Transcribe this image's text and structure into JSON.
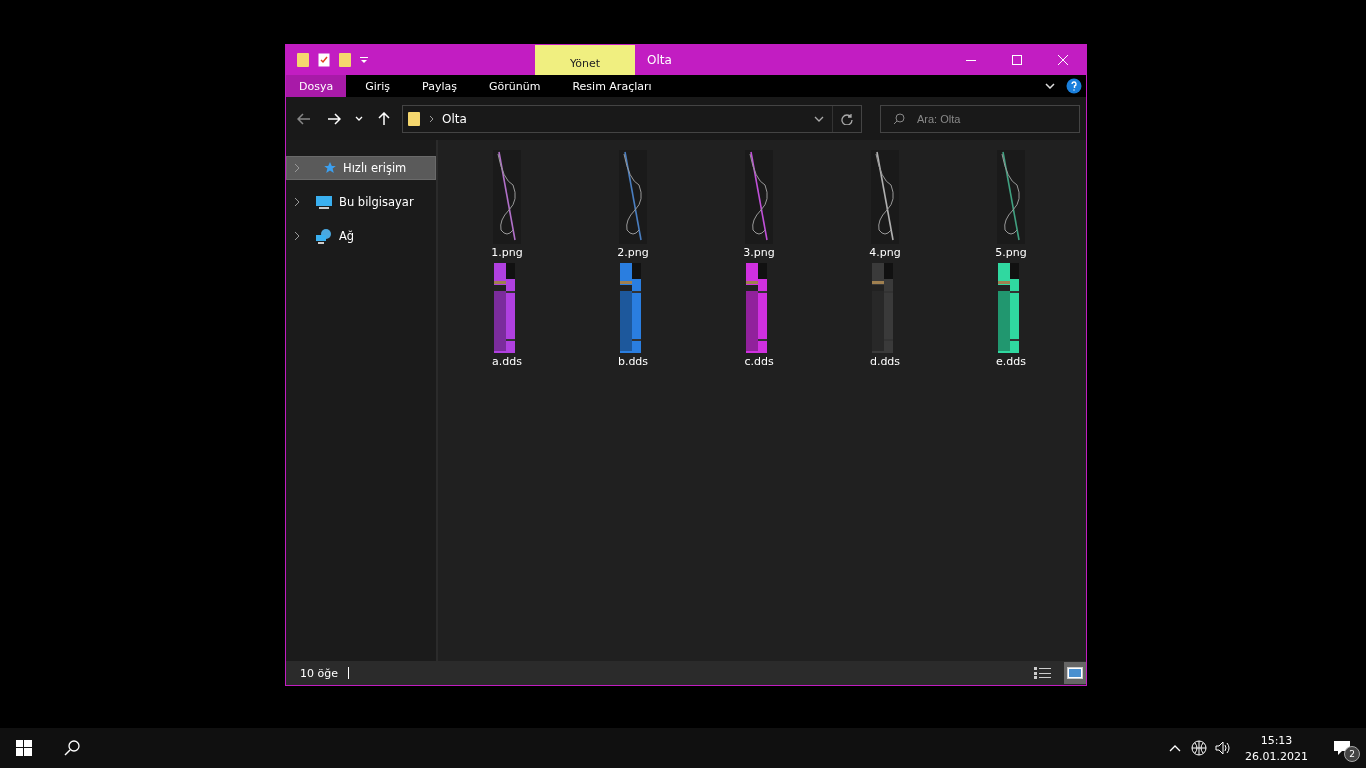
{
  "window": {
    "title": "Olta",
    "context_tab": "Yönet"
  },
  "ribbon_tabs": [
    {
      "label": "Dosya",
      "selected": true
    },
    {
      "label": "Giriş",
      "selected": false
    },
    {
      "label": "Paylaş",
      "selected": false
    },
    {
      "label": "Görünüm",
      "selected": false
    },
    {
      "label": "Resim Araçları",
      "selected": false
    }
  ],
  "address": {
    "path": "Olta"
  },
  "search": {
    "placeholder": "Ara: Olta"
  },
  "sidebar": {
    "items": [
      {
        "label": "Hızlı erişim",
        "kind": "star",
        "selected": true
      },
      {
        "label": "Bu bilgisayar",
        "kind": "computer",
        "selected": false
      },
      {
        "label": "Ağ",
        "kind": "network",
        "selected": false
      }
    ]
  },
  "files": [
    {
      "name": "1.png",
      "kind": "rod",
      "color": "#b070c8"
    },
    {
      "name": "2.png",
      "kind": "rod",
      "color": "#4a7ec0"
    },
    {
      "name": "3.png",
      "kind": "rod",
      "color": "#c050d8"
    },
    {
      "name": "4.png",
      "kind": "rod",
      "color": "#b0b0b0"
    },
    {
      "name": "5.png",
      "kind": "rod",
      "color": "#40a080"
    },
    {
      "name": "a.dds",
      "kind": "grip",
      "color": "#b040e0"
    },
    {
      "name": "b.dds",
      "kind": "grip",
      "color": "#2a7ee0"
    },
    {
      "name": "c.dds",
      "kind": "grip",
      "color": "#d030e0"
    },
    {
      "name": "d.dds",
      "kind": "grip",
      "color": "#3a3a3a"
    },
    {
      "name": "e.dds",
      "kind": "grip",
      "color": "#30d8a0"
    }
  ],
  "status_bar": {
    "count": "10 öğe",
    "views": [
      {
        "kind": "details",
        "selected": false
      },
      {
        "kind": "large",
        "selected": true
      }
    ]
  },
  "taskbar": {
    "time": "15:13",
    "date": "26.01.2021",
    "notifications": "2"
  }
}
